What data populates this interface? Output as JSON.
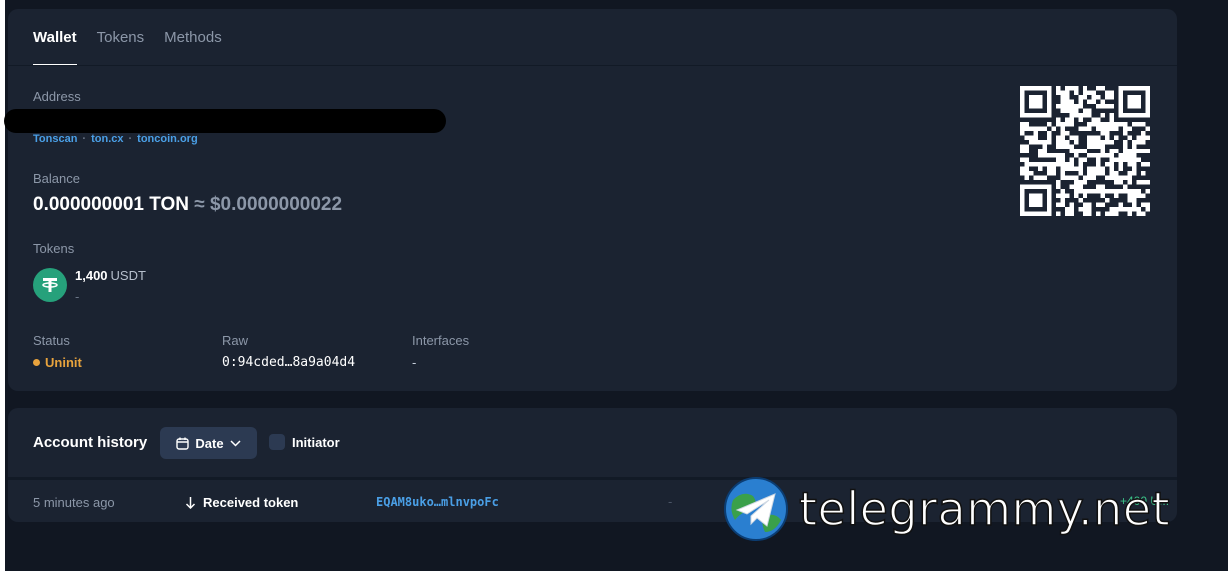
{
  "tabs": [
    {
      "label": "Wallet",
      "active": true
    },
    {
      "label": "Tokens",
      "active": false
    },
    {
      "label": "Methods",
      "active": false
    }
  ],
  "wallet": {
    "address_label": "Address",
    "links": [
      "Tonscan",
      "ton.cx",
      "toncoin.org"
    ],
    "link_separator": "·",
    "balance_label": "Balance",
    "balance_main": "0.000000001 TON",
    "balance_approx": "≈ $0.0000000022",
    "tokens_label": "Tokens",
    "token": {
      "amount": "1,400",
      "symbol": "USDT",
      "sub": "-",
      "icon": "tether-icon",
      "color": "#26a17b"
    },
    "status_label": "Status",
    "status_value": "Uninit",
    "status_color": "#e8a33d",
    "raw_label": "Raw",
    "raw_value": "0:94cded…8a9a04d4",
    "interfaces_label": "Interfaces",
    "interfaces_value": "-"
  },
  "history": {
    "title": "Account history",
    "date_label": "Date",
    "initiator_label": "Initiator",
    "rows": [
      {
        "time": "5 minutes ago",
        "type": "Received token",
        "address": "EQAM8uko…mlnvpoFc",
        "dash": "-",
        "amount": "+400 U..."
      }
    ]
  },
  "watermark": {
    "text": "telegrammy.net"
  },
  "colors": {
    "background": "#111722",
    "card": "#1b2331",
    "link": "#4a9fe6",
    "accent_button": "#2c3a52"
  }
}
